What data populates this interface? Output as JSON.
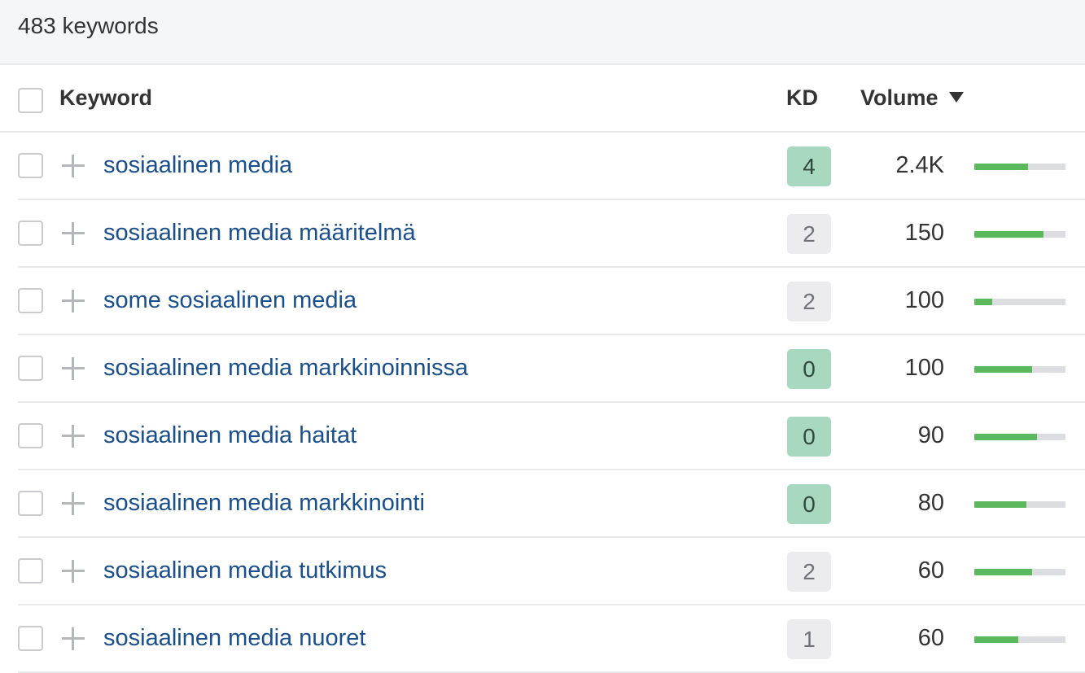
{
  "summary": {
    "text": "483 keywords"
  },
  "header": {
    "keyword": "Keyword",
    "kd": "KD",
    "volume": "Volume"
  },
  "colors": {
    "link": "#1a4f8b",
    "kd_low": "#a9d8c1",
    "kd_neutral": "#ececee",
    "trend": "#5cb85c"
  },
  "rows": [
    {
      "keyword": "sosiaalinen media",
      "kd": "4",
      "kd_level": "low",
      "volume": "2.4K",
      "trend": 0.59
    },
    {
      "keyword": "sosiaalinen media määritelmä",
      "kd": "2",
      "kd_level": "neutral",
      "volume": "150",
      "trend": 0.76
    },
    {
      "keyword": "some sosiaalinen media",
      "kd": "2",
      "kd_level": "neutral",
      "volume": "100",
      "trend": 0.2
    },
    {
      "keyword": "sosiaalinen media markkinoinnissa",
      "kd": "0",
      "kd_level": "low",
      "volume": "100",
      "trend": 0.63
    },
    {
      "keyword": "sosiaalinen media haitat",
      "kd": "0",
      "kd_level": "low",
      "volume": "90",
      "trend": 0.69
    },
    {
      "keyword": "sosiaalinen media markkinointi",
      "kd": "0",
      "kd_level": "low",
      "volume": "80",
      "trend": 0.57
    },
    {
      "keyword": "sosiaalinen media tutkimus",
      "kd": "2",
      "kd_level": "neutral",
      "volume": "60",
      "trend": 0.63
    },
    {
      "keyword": "sosiaalinen media nuoret",
      "kd": "1",
      "kd_level": "neutral",
      "volume": "60",
      "trend": 0.48
    }
  ]
}
